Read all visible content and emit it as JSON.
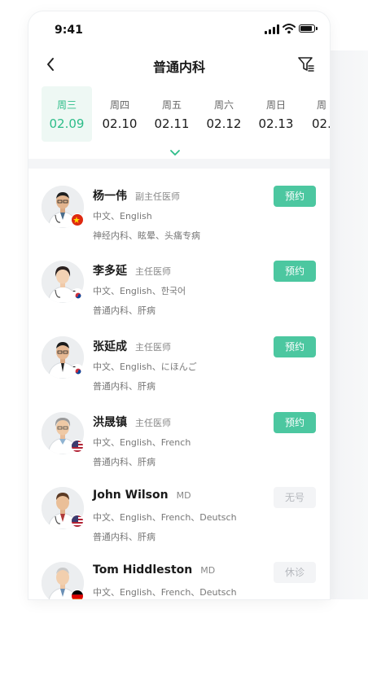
{
  "status_bar": {
    "time": "9:41"
  },
  "nav": {
    "title": "普通内科"
  },
  "dates": [
    {
      "weekday": "周三",
      "date": "02.09",
      "active": true
    },
    {
      "weekday": "周四",
      "date": "02.10",
      "active": false
    },
    {
      "weekday": "周五",
      "date": "02.11",
      "active": false
    },
    {
      "weekday": "周六",
      "date": "02.12",
      "active": false
    },
    {
      "weekday": "周日",
      "date": "02.13",
      "active": false
    },
    {
      "weekday": "周",
      "date": "02.",
      "active": false
    }
  ],
  "doctors": [
    {
      "name": "杨一伟",
      "title": "副主任医师",
      "languages": "中文、English",
      "specialty": "神经内科、眩晕、头痛专病",
      "button": "预约",
      "button_state": "available",
      "flag": "china-flag-icon"
    },
    {
      "name": "李多延",
      "title": "主任医师",
      "languages": "中文、English、한국어",
      "specialty": "普通内科、肝病",
      "button": "预约",
      "button_state": "available",
      "flag": "korea-flag-icon"
    },
    {
      "name": "张延成",
      "title": "主任医师",
      "languages": "中文、English、にほんご",
      "specialty": "普通内科、肝病",
      "button": "预约",
      "button_state": "available",
      "flag": "korea-flag-icon"
    },
    {
      "name": "洪晟镇",
      "title": "主任医师",
      "languages": "中文、English、French",
      "specialty": "普通内科、肝病",
      "button": "预约",
      "button_state": "available",
      "flag": "usa-flag-icon"
    },
    {
      "name": "John Wilson",
      "title": "MD",
      "languages": "中文、English、French、Deutsch",
      "specialty": "普通内科、肝病",
      "button": "无号",
      "button_state": "unavailable",
      "flag": "usa-flag-icon"
    },
    {
      "name": "Tom Hiddleston",
      "title": "MD",
      "languages": "中文、English、French、Deutsch",
      "specialty": "",
      "button": "休诊",
      "button_state": "unavailable",
      "flag": "germany-flag-icon"
    }
  ],
  "colors": {
    "accent": "#2dbd89",
    "button_green": "#4cc7a0",
    "button_gray": "#f3f4f6"
  }
}
